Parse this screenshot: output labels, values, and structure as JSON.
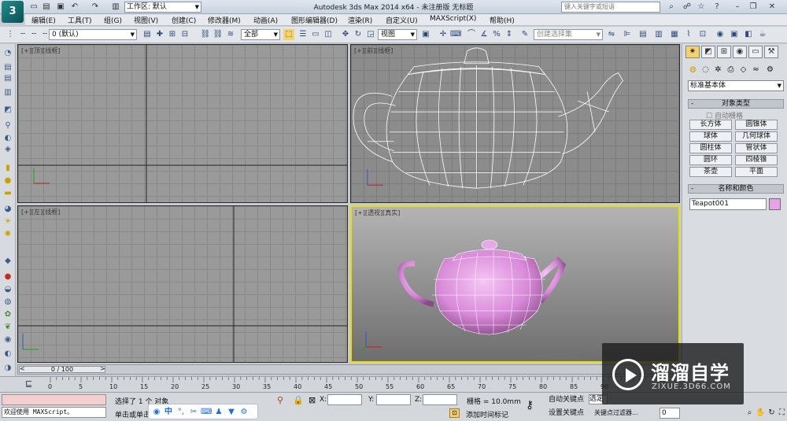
{
  "app": {
    "logo": "3",
    "title": "Autodesk 3ds Max  2014 x64  - 未注册版   无标题",
    "workspace": "工作区: 默认",
    "help_search_placeholder": "键入关键字或短语"
  },
  "menu": [
    "编辑(E)",
    "工具(T)",
    "组(G)",
    "视图(V)",
    "创建(C)",
    "修改器(M)",
    "动画(A)",
    "图形编辑器(D)",
    "渲染(R)",
    "自定义(U)",
    "MAXScript(X)",
    "帮助(H)"
  ],
  "toolbar": {
    "layer_dropdown": "0 (默认)",
    "selection_filter": "全部",
    "ref_coord": "视图",
    "named_selection_placeholder": "创建选择集"
  },
  "viewports": {
    "top": "[+][顶][线框]",
    "front": "[+][前][线框]",
    "left": "[+][左][线框]",
    "perspective": "[+][透视][真实]"
  },
  "command_panel": {
    "category_dropdown": "标准基本体",
    "object_type_title": "对象类型",
    "autogrid": "自动栅格",
    "buttons": [
      "长方体",
      "圆锥体",
      "球体",
      "几何球体",
      "圆柱体",
      "管状体",
      "圆环",
      "四棱锥",
      "茶壶",
      "平面"
    ],
    "name_color_title": "名称和颜色",
    "object_name": "Teapot001",
    "object_color": "#e8a2e8"
  },
  "timeline": {
    "slider_label": "0 / 100",
    "ticks": [
      "0",
      "5",
      "10",
      "15",
      "20",
      "25",
      "30",
      "35",
      "40",
      "45",
      "50",
      "55",
      "60",
      "65",
      "70",
      "75",
      "80",
      "85",
      "90"
    ]
  },
  "status": {
    "maxscript": "欢迎使用 MAXScript。",
    "selection": "选择了 1 个 对象",
    "prompt": "单击或单击",
    "x_label": "X:",
    "y_label": "Y:",
    "z_label": "Z:",
    "grid": "栅格 = 10.0mm",
    "add_time_tag": "添加时间标记",
    "auto_key": "自动关键点",
    "set_key": "设置关键点",
    "selected": "选定",
    "key_filters": "关键点过滤器...",
    "frame": "0"
  },
  "ime": {
    "mode": "中"
  },
  "watermark": {
    "title": "溜溜自学",
    "sub": "ZIXUE.3D66.COM"
  }
}
